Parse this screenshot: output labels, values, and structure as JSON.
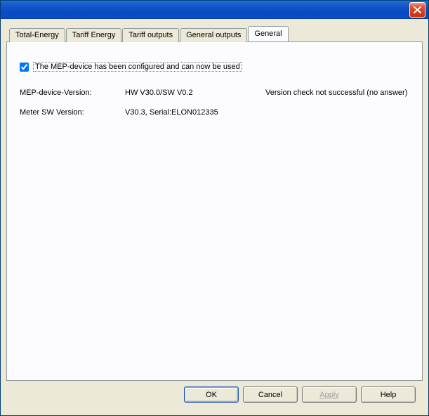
{
  "tabs": {
    "total_energy": "Total-Energy",
    "tariff_energy": "Tariff Energy",
    "tariff_outputs": "Tariff outputs",
    "general_outputs": "General outputs",
    "general": "General"
  },
  "general_tab": {
    "configured_label": "The MEP-device has been configured and can now be used",
    "configured_checked": true,
    "version_label": "MEP-device-Version:",
    "version_value": "HW V30.0/SW V0.2",
    "version_check_status": "Version check not successful (no answer)",
    "meter_sw_label": "Meter SW Version:",
    "meter_sw_value": "V30.3, Serial:ELON012335"
  },
  "buttons": {
    "ok": "OK",
    "cancel": "Cancel",
    "apply": "Apply",
    "help": "Help"
  }
}
